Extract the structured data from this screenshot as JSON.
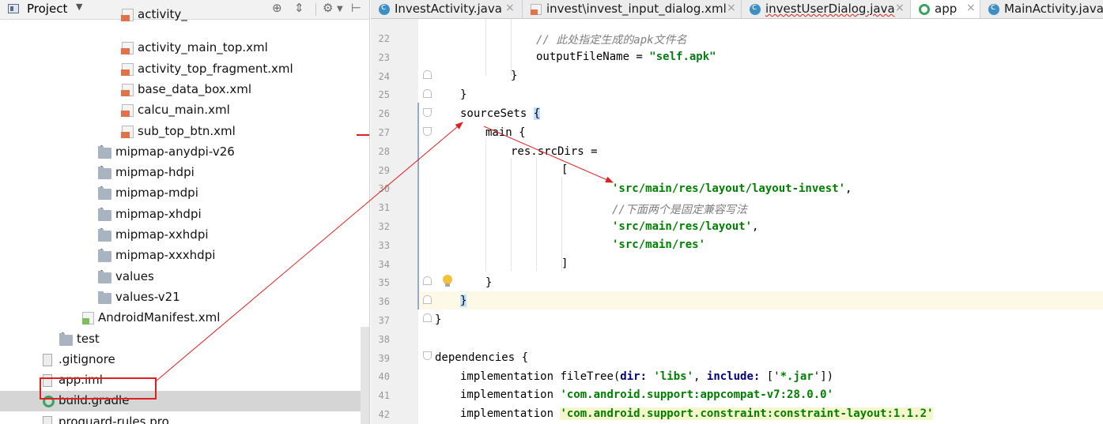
{
  "project": {
    "title": "Project",
    "tree": [
      {
        "label": "activity_",
        "kind": "xml",
        "indent": 176
      },
      {
        "label": "activity_main_top.xml",
        "kind": "xml",
        "indent": 176
      },
      {
        "label": "activity_top_fragment.xml",
        "kind": "xml",
        "indent": 176
      },
      {
        "label": "base_data_box.xml",
        "kind": "xml",
        "indent": 176
      },
      {
        "label": "calcu_main.xml",
        "kind": "xml",
        "indent": 176
      },
      {
        "label": "sub_top_btn.xml",
        "kind": "xml",
        "indent": 176
      },
      {
        "label": "mipmap-anydpi-v26",
        "kind": "folder",
        "indent": 150,
        "expandable": true
      },
      {
        "label": "mipmap-hdpi",
        "kind": "folder",
        "indent": 150,
        "expandable": true
      },
      {
        "label": "mipmap-mdpi",
        "kind": "folder",
        "indent": 150,
        "expandable": true
      },
      {
        "label": "mipmap-xhdpi",
        "kind": "folder",
        "indent": 150,
        "expandable": true
      },
      {
        "label": "mipmap-xxhdpi",
        "kind": "folder",
        "indent": 150,
        "expandable": true
      },
      {
        "label": "mipmap-xxxhdpi",
        "kind": "folder",
        "indent": 150,
        "expandable": true
      },
      {
        "label": "values",
        "kind": "folder",
        "indent": 150,
        "expandable": true
      },
      {
        "label": "values-v21",
        "kind": "folder",
        "indent": 150,
        "expandable": false
      },
      {
        "label": "AndroidManifest.xml",
        "kind": "manifest",
        "indent": 126
      },
      {
        "label": "test",
        "kind": "folder",
        "indent": 101,
        "expandable": true
      },
      {
        "label": ".gitignore",
        "kind": "file",
        "indent": 76
      },
      {
        "label": "app.iml",
        "kind": "file",
        "indent": 76
      },
      {
        "label": "build.gradle",
        "kind": "gradle",
        "indent": 76,
        "selected": true
      },
      {
        "label": "proguard-rules.pro",
        "kind": "file",
        "indent": 76
      }
    ]
  },
  "tabs": [
    {
      "label": "InvestActivity.java",
      "icon": "java"
    },
    {
      "label": "invest\\invest_input_dialog.xml",
      "icon": "xml"
    },
    {
      "label": "investUserDialog.java",
      "icon": "java",
      "error": true
    },
    {
      "label": "app",
      "icon": "gradle",
      "active": true
    },
    {
      "label": "MainActivity.java",
      "icon": "java"
    }
  ],
  "lines": {
    "numbers": [
      "22",
      "23",
      "24",
      "25",
      "26",
      "27",
      "28",
      "29",
      "30",
      "31",
      "32",
      "33",
      "34",
      "35",
      "36",
      "37",
      "38",
      "39",
      "40",
      "41",
      "42"
    ],
    "l22": "// 此处指定生成的apk文件名",
    "l23a": "outputFileName = ",
    "l23b": "\"self.apk\"",
    "l24": "}",
    "l25": "}",
    "l26a": "sourceSets ",
    "l26b": "{",
    "l27": "main {",
    "l28": "res.srcDirs =",
    "l29": "[",
    "l30a": "'src/main/res/layout/layout-invest'",
    "l30b": ",",
    "l31": "//下面两个是固定兼容写法",
    "l32a": "'src/main/res/layout'",
    "l32b": ",",
    "l33": "'src/main/res'",
    "l34": "]",
    "l35": "}",
    "l36": "}",
    "l37": "}",
    "l39": "dependencies {",
    "l40a": "implementation ",
    "l40b": "fileTree(",
    "l40c": "dir: ",
    "l40d": "'libs'",
    "l40e": ", ",
    "l40f": "include: ",
    "l40g": "['",
    "l40h": "*.jar",
    "l40i": "'])",
    "l41a": "implementation ",
    "l41b": "'com.android.support:appcompat-v7:28.0.0'",
    "l42a": "implementation ",
    "l42b": "'com.android.support.constraint:constraint-layout:1.1.2'"
  },
  "colors": {
    "annotation_red": "#e02020",
    "string_green": "#067d17",
    "keyword_navy": "#000080"
  }
}
